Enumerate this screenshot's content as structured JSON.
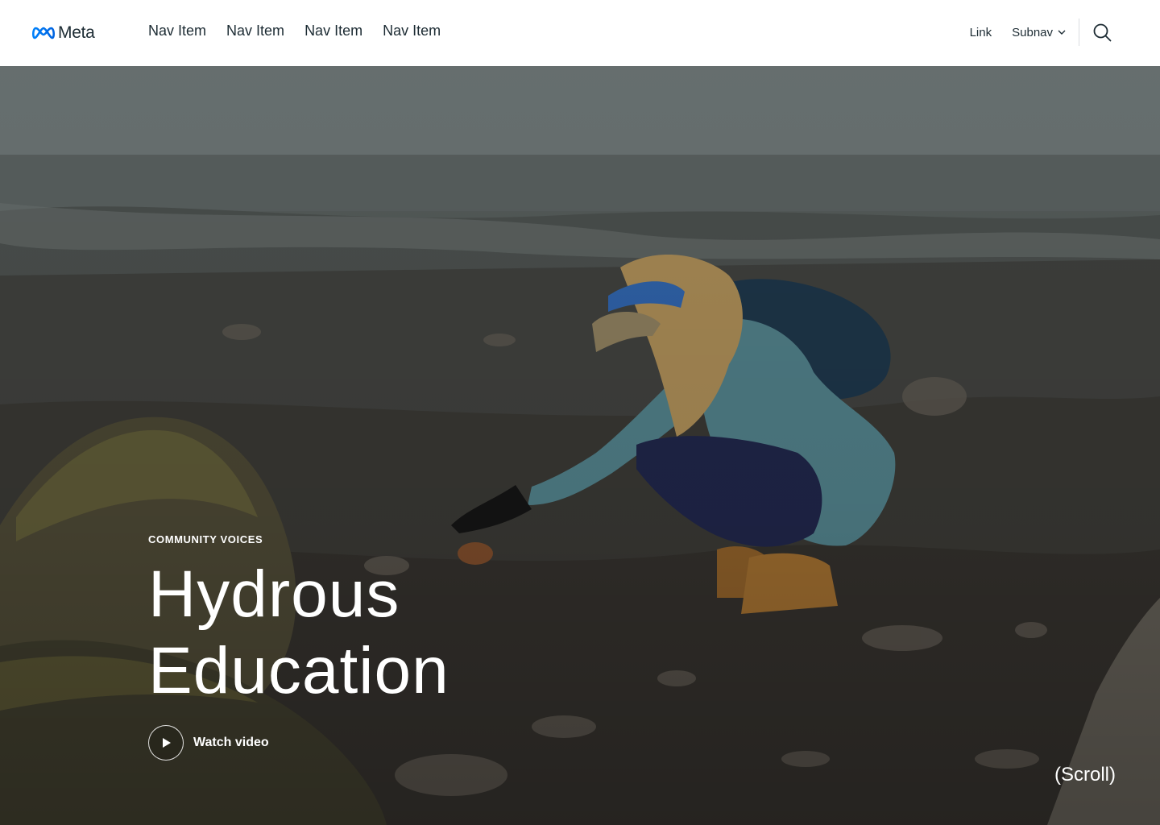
{
  "header": {
    "logo_text": "Meta",
    "nav_items": [
      "Nav Item",
      "Nav Item",
      "Nav Item",
      "Nav Item"
    ],
    "link_label": "Link",
    "subnav_label": "Subnav"
  },
  "hero": {
    "eyebrow": "COMMUNITY VOICES",
    "title_line1": "Hydrous",
    "title_line2": "Education",
    "watch_label": "Watch video",
    "scroll_label": "(Scroll)"
  },
  "colors": {
    "brand_blue": "#0668E1",
    "text_dark": "#1c2b33",
    "hero_text": "#ffffff"
  },
  "icons": [
    "meta-infinity-logo-icon",
    "chevron-down-icon",
    "search-icon",
    "play-icon"
  ]
}
